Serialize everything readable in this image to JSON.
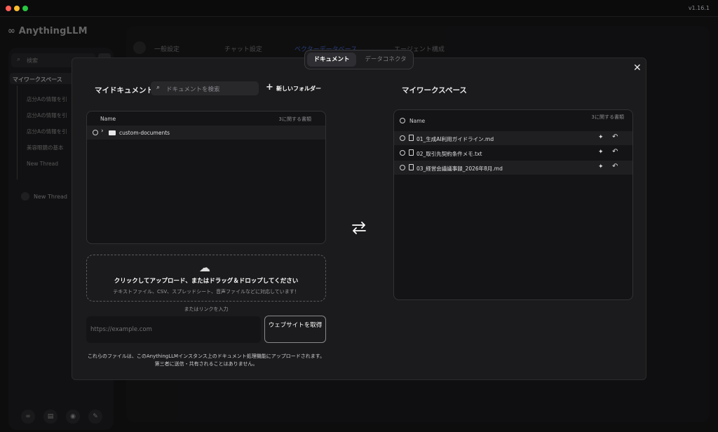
{
  "app": {
    "version": "v1.16.1",
    "logo": "AnythingLLM"
  },
  "sidebar": {
    "search_placeholder": "検索",
    "workspace": "マイワークスペース",
    "threads": [
      "店分Aの情報を引",
      "店分Aの情報を引",
      "店分Aの情報を引",
      "美容眼鏡の基本",
      "New Thread"
    ],
    "new_thread": "New Thread"
  },
  "background_tabs": [
    "一般設定",
    "チャット設定",
    "ベクターデータベース",
    "エージェント構成"
  ],
  "modal": {
    "tabs": {
      "documents": "ドキュメント",
      "connectors": "データコネクタ"
    },
    "my_documents": {
      "title": "マイドキュメント",
      "search_placeholder": "ドキュメントを検索",
      "new_folder": "新しいフォルダー",
      "header_name": "Name",
      "header_count": "3に関する書類",
      "items": [
        {
          "name": "custom-documents",
          "type": "folder"
        }
      ]
    },
    "upload": {
      "title": "クリックしてアップロード、またはドラッグ＆ドロップしてください",
      "subtitle": "テキストファイル、CSV、スプレッドシート、音声ファイルなどに対応しています！",
      "or_link": "またはリンクを入力",
      "url_placeholder": "https://example.com",
      "fetch_button": "ウェブサイトを取得",
      "notice": "これらのファイルは、このAnythingLLMインスタンス上のドキュメント処理機能にアップロードされます。第三者に送信・共有されることはありません。"
    },
    "my_workspace": {
      "title": "マイワークスペース",
      "header_name": "Name",
      "header_count": "3に関する書類",
      "files": [
        "01_生成AI利用ガイドライン.md",
        "02_取引先契約条件メモ.txt",
        "03_経営会議議事録_2026年8月.md"
      ]
    }
  }
}
